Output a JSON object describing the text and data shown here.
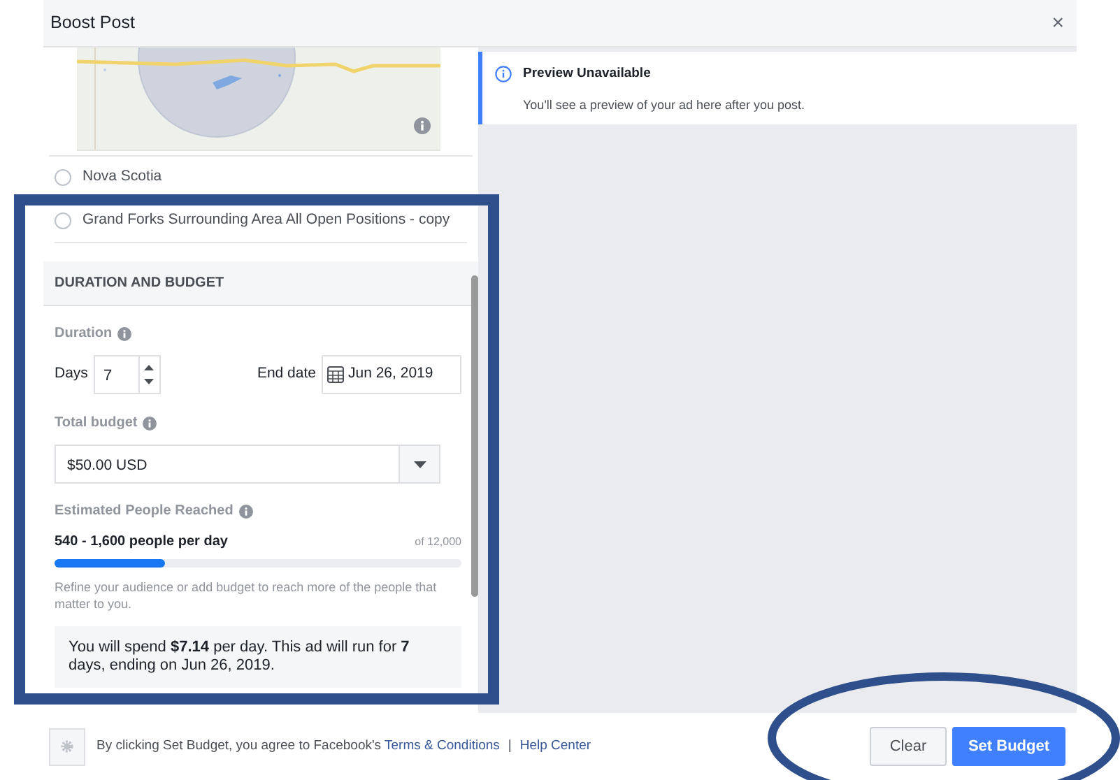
{
  "window": {
    "title": "Boost Post",
    "close": "×"
  },
  "audiences": [
    {
      "name": "Nova Scotia",
      "selected": false
    },
    {
      "name": "Grand Forks Surrounding Area All Open Positions - copy",
      "selected": false
    }
  ],
  "duration_budget": {
    "title": "DURATION AND BUDGET",
    "duration_label": "Duration",
    "days_label": "Days",
    "days_value": "7",
    "end_date_label": "End date",
    "end_date_value": "Jun 26, 2019",
    "budget_label": "Total budget",
    "budget_value": "$50.00 USD",
    "reach_label": "Estimated People Reached",
    "reach_value": "540 - 1,600 people per day",
    "reach_total": "of 12,000",
    "level": 0.27,
    "hint": "Refine your audience or add budget to reach more of the people that matter to you.",
    "summary": "You will spend **$7.14** per day. This ad will run for **7** days, ending on Jun 26, 2019."
  },
  "preview": {
    "title": "Preview Unavailable",
    "message": "You'll see a preview of your ad here after you post."
  },
  "footer": {
    "text": "By clicking Set Budget, you agree to Facebook's",
    "links": [
      "Terms & Conditions",
      "Help Center"
    ],
    "separator": "|"
  },
  "buttons": [
    {
      "label": "Clear",
      "kind": "secondary"
    },
    {
      "label": "Set Budget",
      "kind": "primary"
    }
  ]
}
